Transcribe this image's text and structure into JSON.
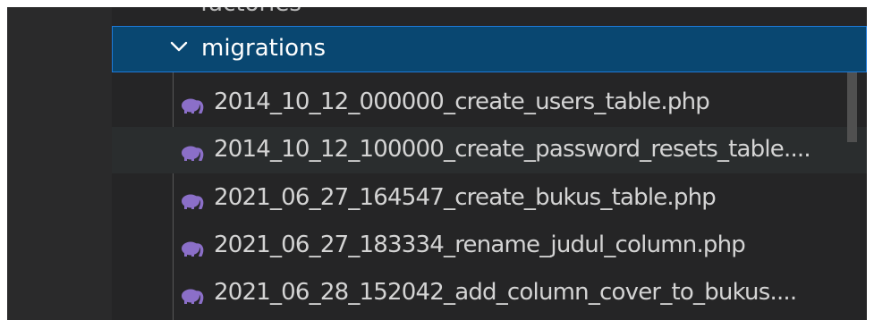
{
  "explorer": {
    "partial_folder_label": "factories",
    "open_folder": {
      "label": "migrations",
      "icon": "chevron-down-icon"
    },
    "files": [
      {
        "label": "2014_10_12_000000_create_users_table.php",
        "icon": "php-elephant-icon"
      },
      {
        "label": "2014_10_12_100000_create_password_resets_table....",
        "icon": "php-elephant-icon"
      },
      {
        "label": "2021_06_27_164547_create_bukus_table.php",
        "icon": "php-elephant-icon"
      },
      {
        "label": "2021_06_27_183334_rename_judul_column.php",
        "icon": "php-elephant-icon"
      },
      {
        "label": "2021_06_28_152042_add_column_cover_to_bukus....",
        "icon": "php-elephant-icon"
      }
    ]
  },
  "colors": {
    "background": "#252526",
    "selected_row": "#094771",
    "selected_border": "#1e7ad8",
    "hover_row": "#2a2d2e",
    "text": "#d4d4d4",
    "php_icon": "#8b6fc8"
  }
}
